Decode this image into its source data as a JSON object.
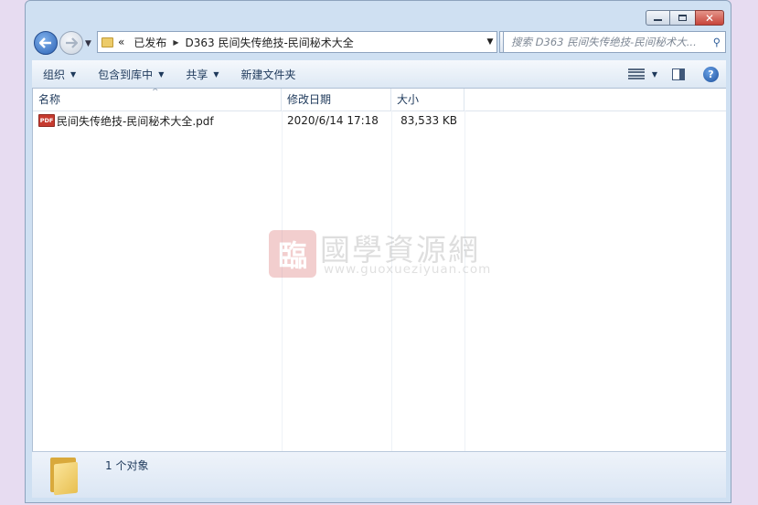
{
  "window": {
    "caption_buttons": {
      "minimize": "",
      "maximize": "",
      "close": "✕"
    }
  },
  "nav": {
    "breadcrumbs": [
      "已发布",
      "D363 民间失传绝技-民间秘术大全"
    ],
    "overflow_label": "«",
    "search_placeholder": "搜索 D363 民间失传绝技-民间秘术大..."
  },
  "toolbar": {
    "organize_label": "组织",
    "include_library_label": "包含到库中",
    "share_label": "共享",
    "new_folder_label": "新建文件夹"
  },
  "columns": {
    "name": "名称",
    "date": "修改日期",
    "size": "大小"
  },
  "files": [
    {
      "icon": "pdf-icon",
      "icon_label": "PDF",
      "name": "民间失传绝技-民间秘术大全.pdf",
      "modified": "2020/6/14 17:18",
      "size": "83,533 KB"
    }
  ],
  "watermark": {
    "seal": "臨",
    "title": "國學資源網",
    "url": "www.guoxueziyuan.com"
  },
  "details": {
    "count_text": "1 个对象"
  },
  "colors": {
    "accent": "#2d63b5",
    "window_frame": "#cfe0f2",
    "pdf_red": "#c63a2f"
  }
}
